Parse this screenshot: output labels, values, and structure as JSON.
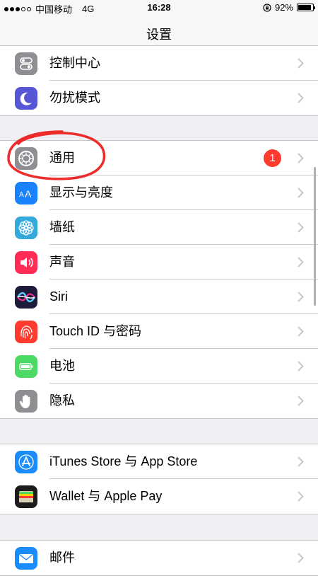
{
  "status_bar": {
    "carrier": "中国移动",
    "network": "4G",
    "time": "16:28",
    "battery_percent": "92%",
    "battery_level": 0.92,
    "signal_filled": 3,
    "signal_total": 5
  },
  "nav": {
    "title": "设置"
  },
  "groups": [
    {
      "items": [
        {
          "label": "控制中心",
          "icon": "control-center-icon",
          "color": "#8e8e93"
        },
        {
          "label": "勿扰模式",
          "icon": "moon-icon",
          "color": "#5856d6"
        }
      ]
    },
    {
      "items": [
        {
          "label": "通用",
          "icon": "gear-icon",
          "color": "#8e8e93",
          "badge": "1"
        },
        {
          "label": "显示与亮度",
          "icon": "text-size-icon",
          "color": "#1a82fb"
        },
        {
          "label": "墙纸",
          "icon": "flower-icon",
          "color": "#34aadc"
        },
        {
          "label": "声音",
          "icon": "speaker-icon",
          "color": "#ff2d55"
        },
        {
          "label": "Siri",
          "icon": "siri-icon",
          "color": "#1c1c3a"
        },
        {
          "label": "Touch ID 与密码",
          "icon": "fingerprint-icon",
          "color": "#ff3b30"
        },
        {
          "label": "电池",
          "icon": "battery-icon",
          "color": "#4cd964"
        },
        {
          "label": "隐私",
          "icon": "hand-icon",
          "color": "#8e8e93"
        }
      ]
    },
    {
      "items": [
        {
          "label": "iTunes Store 与 App Store",
          "icon": "app-store-icon",
          "color": "#1a8cfb"
        },
        {
          "label": "Wallet 与 Apple Pay",
          "icon": "wallet-icon",
          "color": "#1c1c1c"
        }
      ]
    },
    {
      "items": [
        {
          "label": "邮件",
          "icon": "mail-icon",
          "color": "#1a8cfb"
        }
      ]
    }
  ]
}
